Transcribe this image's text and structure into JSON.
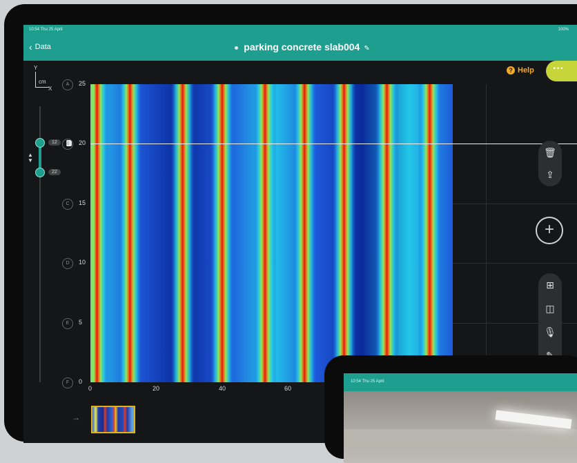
{
  "status_bar": {
    "time": "10:54 Thu 25 April",
    "battery": "100%"
  },
  "nav": {
    "back_label": "Data",
    "title": "parking concrete slab004"
  },
  "help_label": "Help",
  "more_label": "···",
  "axis_icon": {
    "y": "Y",
    "unit": "cm",
    "x": "X"
  },
  "range_slider": {
    "top_value": "12",
    "bottom_value": "22"
  },
  "row_labels": [
    "A",
    "B",
    "C",
    "D",
    "E",
    "F"
  ],
  "chart_data": {
    "type": "heatmap",
    "title": "",
    "xlabel": "",
    "ylabel": "",
    "xlim": [
      0,
      110
    ],
    "ylim": [
      0,
      25
    ],
    "x_ticks": [
      "0",
      "20",
      "40",
      "60"
    ],
    "y_ticks": [
      "0",
      "5",
      "10",
      "15",
      "20",
      "25"
    ],
    "x_extent": [
      0,
      110
    ],
    "hot_bands_x": [
      2,
      12,
      28,
      40,
      53,
      65,
      77,
      90,
      103
    ],
    "cursor_y": 20,
    "colormap": [
      "#0a2a9a",
      "#1e5adc",
      "#22c8e8",
      "#8ee858",
      "#f8d020",
      "#f45a14",
      "#d41a10"
    ]
  },
  "tools": {
    "delete": "trash-icon",
    "share": "share-icon",
    "add": "+",
    "layout": "grid-icon",
    "split": "split-view-icon",
    "mic": "mic-icon",
    "pen": "pencil-icon"
  },
  "phone": {
    "time": "10:54 Thu 25 April"
  }
}
